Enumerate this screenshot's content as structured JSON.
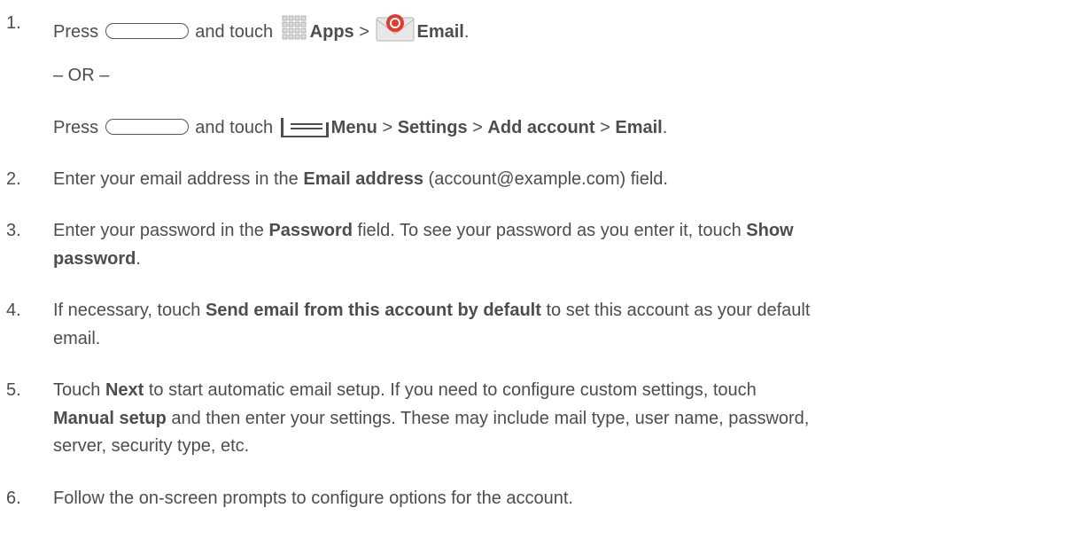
{
  "steps": [
    {
      "n": "1.",
      "parts": [
        "Press",
        "and touch",
        "Apps",
        ">",
        "Email",
        "."
      ]
    },
    {
      "or": "– OR –"
    },
    {
      "parts": [
        "Press",
        "and touch",
        "Menu",
        ">",
        "Settings",
        ">",
        "Add account",
        ">",
        "Email",
        "."
      ]
    },
    {
      "n": "2.",
      "a": "Enter your email address in the ",
      "b": "Email address",
      "c": " (account@example.com) field."
    },
    {
      "n": "3.",
      "a": "Enter your password in the ",
      "b": "Password",
      "c": " field. To see your password as you enter it, touch ",
      "d": "Show",
      "e": "password",
      "f": "."
    },
    {
      "n": "4.",
      "a": "If necessary, touch ",
      "b": "Send email from this account by default",
      "c": " to set this account as your default",
      "d": "email."
    },
    {
      "n": "5.",
      "a": "Touch ",
      "b": "Next",
      "c": " to start automatic email setup. If you need to configure custom settings, touch",
      "d": "Manual setup",
      "e": " and then enter your settings. These may include mail type, user name, password,",
      "f": "server, security type, etc."
    },
    {
      "n": "6.",
      "a": "Follow the on-screen prompts to configure options for the account."
    }
  ],
  "icons": {
    "home_button": "home-button-icon",
    "apps": "apps-grid-icon",
    "email": "email-app-icon",
    "menu": "menu-icon"
  },
  "colors": {
    "text": "#4d4d4d",
    "email_icon_red": "#e23b2e"
  }
}
